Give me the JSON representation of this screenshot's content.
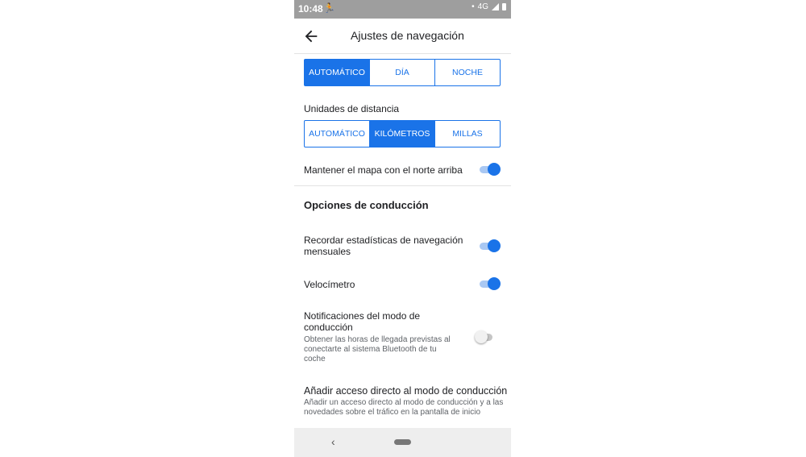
{
  "status_bar": {
    "time": "10:48",
    "network": "4G"
  },
  "header": {
    "title": "Ajustes de navegación"
  },
  "mode_selector": {
    "options": [
      "AUTOMÁTICO",
      "DÍA",
      "NOCHE"
    ],
    "selected": "AUTOMÁTICO"
  },
  "distance_units": {
    "label": "Unidades de distancia",
    "options": [
      "AUTOMÁTICO",
      "KILÓMETROS",
      "MILLAS"
    ],
    "selected": "KILÓMETROS"
  },
  "north_up": {
    "label": "Mantener el mapa con el norte arriba",
    "enabled": true
  },
  "driving_section": {
    "title": "Opciones de conducción"
  },
  "settings": [
    {
      "label": "Recordar estadísticas de navegación mensuales",
      "enabled": true
    },
    {
      "label": "Velocímetro",
      "enabled": true
    },
    {
      "label": "Notificaciones del modo de conducción",
      "description": "Obtener las horas de llegada previstas al conectarte al sistema Bluetooth de tu coche",
      "enabled": false
    },
    {
      "label": "Añadir acceso directo al modo de conducción",
      "description": "Añadir un acceso directo al modo de conducción y a las novedades sobre el tráfico en la pantalla de inicio"
    }
  ],
  "colors": {
    "accent": "#1a73e8",
    "status_bar": "#9e9e9e"
  }
}
